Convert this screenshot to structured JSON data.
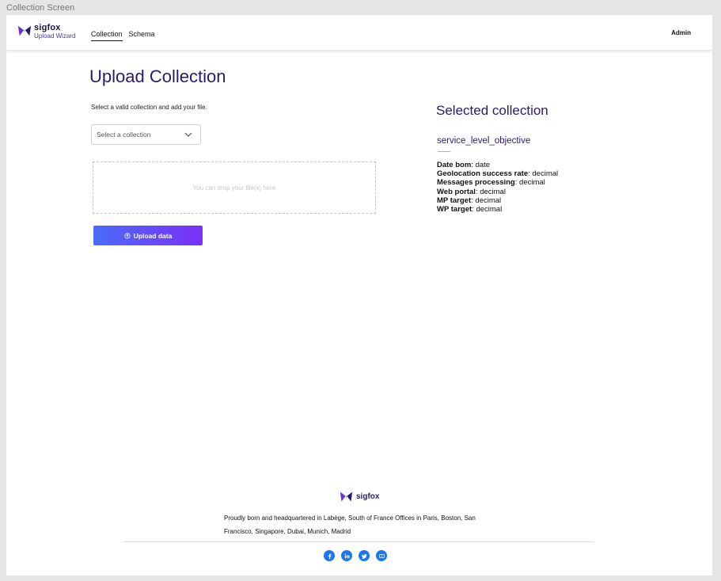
{
  "frame_label": "Collection Screen",
  "header": {
    "brand": "sigfox",
    "brand_sub": "Upload Wizard",
    "nav": [
      {
        "label": "Collection",
        "active": true
      },
      {
        "label": "Schema",
        "active": false
      }
    ],
    "user": "Admin"
  },
  "main": {
    "title": "Upload Collection",
    "instructions": "Select a valid collection and add your file.",
    "select_placeholder": "Select a collection",
    "dropzone_text": "You can drop your file(s) here",
    "upload_button": "Upload data"
  },
  "selected": {
    "title": "Selected collection",
    "name": "service_level_objective",
    "fields": [
      {
        "name": "Date bom",
        "type": "date"
      },
      {
        "name": "Geolocation success rate",
        "type": "decimal"
      },
      {
        "name": "Messages processing",
        "type": "decimal"
      },
      {
        "name": "Web portal",
        "type": "decimal"
      },
      {
        "name": "MP target",
        "type": "decimal"
      },
      {
        "name": "WP target",
        "type": "decimal"
      }
    ]
  },
  "footer": {
    "brand": "sigfox",
    "text": "Proudly born and headquartered in Labège, South of France Offices in Paris, Boston, San Francisco, Singapore, Dubai, Munich, Madrid",
    "socials": [
      "facebook-icon",
      "linkedin-icon",
      "twitter-icon",
      "youtube-icon"
    ]
  },
  "colors": {
    "primary": "#2a1a6e",
    "gradient_start": "#4a6cf7",
    "gradient_end": "#7b2ff7",
    "social": "#1877f2"
  }
}
